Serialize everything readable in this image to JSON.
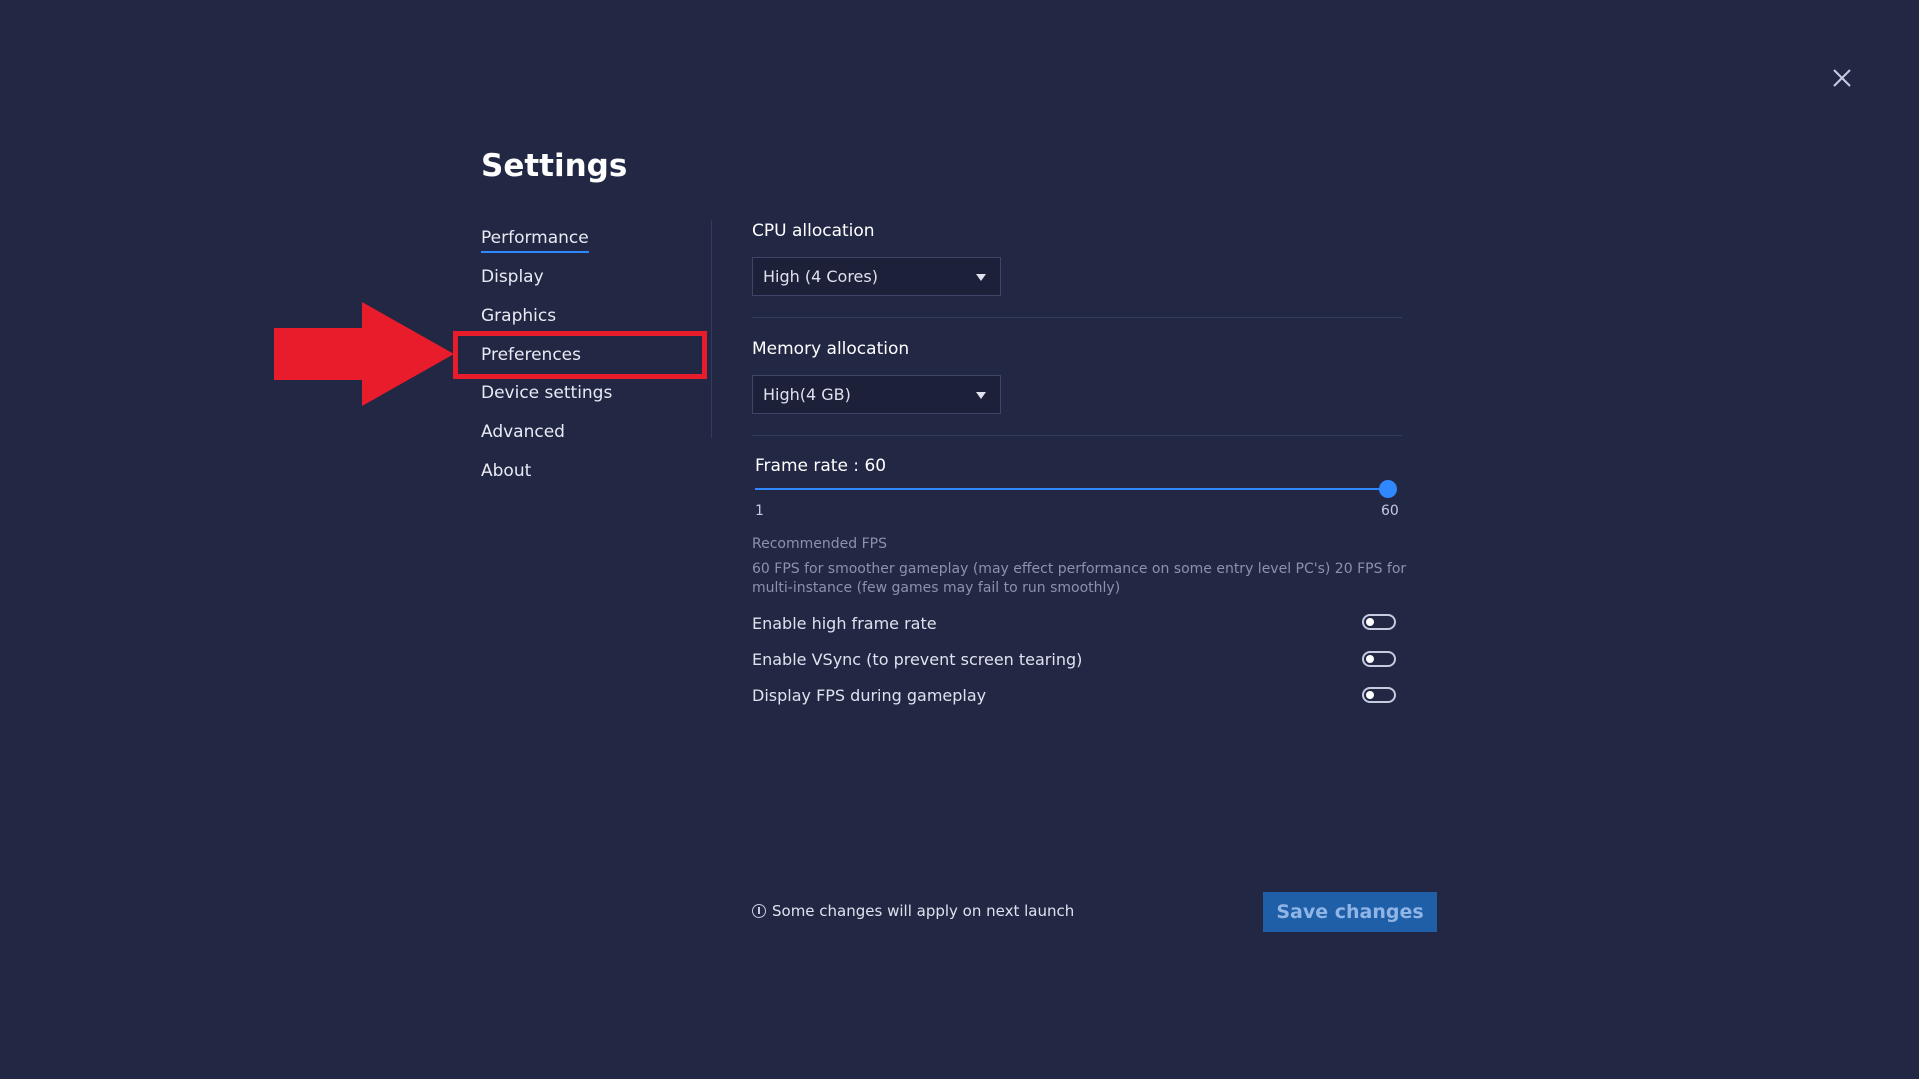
{
  "title": "Settings",
  "nav": {
    "items": [
      {
        "label": "Performance"
      },
      {
        "label": "Display"
      },
      {
        "label": "Graphics"
      },
      {
        "label": "Preferences"
      },
      {
        "label": "Device settings"
      },
      {
        "label": "Advanced"
      },
      {
        "label": "About"
      }
    ],
    "active": "Performance",
    "highlighted": "Preferences"
  },
  "cpu": {
    "label": "CPU allocation",
    "value": "High (4 Cores)"
  },
  "memory": {
    "label": "Memory allocation",
    "value": "High(4 GB)"
  },
  "frame_rate": {
    "label": "Frame rate : 60",
    "value": 60,
    "min_label": "1",
    "max_label": "60"
  },
  "recommended": {
    "title": "Recommended FPS",
    "text": "60 FPS for smoother gameplay (may effect performance on some entry level PC's) 20 FPS for multi-instance (few games may fail to run smoothly)"
  },
  "toggles": [
    {
      "label": "Enable high frame rate",
      "on": false
    },
    {
      "label": "Enable VSync (to prevent screen tearing)",
      "on": false
    },
    {
      "label": "Display FPS during gameplay",
      "on": false
    }
  ],
  "footer": {
    "notice": "Some changes will apply on next launch",
    "save_label": "Save changes"
  },
  "colors": {
    "background": "#222744",
    "accent": "#2f88ff",
    "highlight": "#e81c2a",
    "save_button": "#1f5fa8"
  },
  "icons": [
    "close-icon",
    "chevron-down-icon",
    "info-icon",
    "arrow-icon"
  ]
}
